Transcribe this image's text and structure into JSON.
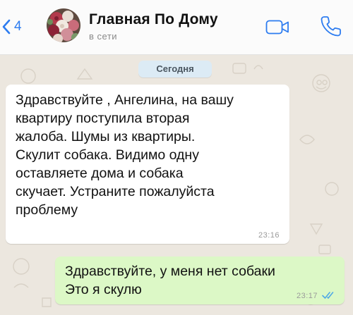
{
  "header": {
    "back_count": "4",
    "title": "Главная По Дому",
    "status": "в сети"
  },
  "chat": {
    "date_label": "Сегодня",
    "messages": [
      {
        "direction": "incoming",
        "lines": [
          "Здравствуйте , Ангелина, на вашу",
          "квартиру поступила вторая",
          "жалоба. Шумы из квартиры.",
          "Скулит собака. Видимо одну",
          "оставляете дома и собака",
          "скучает. Устраните пожалуйста",
          "проблему"
        ],
        "time": "23:16"
      },
      {
        "direction": "outgoing",
        "lines": [
          "Здравствуйте, у меня нет собаки",
          "Это я скулю"
        ],
        "time": "23:17",
        "status_icon": "double-check-icon"
      }
    ]
  },
  "icons": {
    "back": "chevron-left-icon",
    "video": "video-camera-icon",
    "call": "phone-icon",
    "read": "double-check-icon"
  },
  "colors": {
    "accent": "#2d7cf0",
    "outgoing_bubble": "#dcf8c6",
    "incoming_bubble": "#ffffff",
    "chat_background": "#ece7df",
    "date_pill": "#dcebf5",
    "read_ticks": "#4fa9e6"
  }
}
